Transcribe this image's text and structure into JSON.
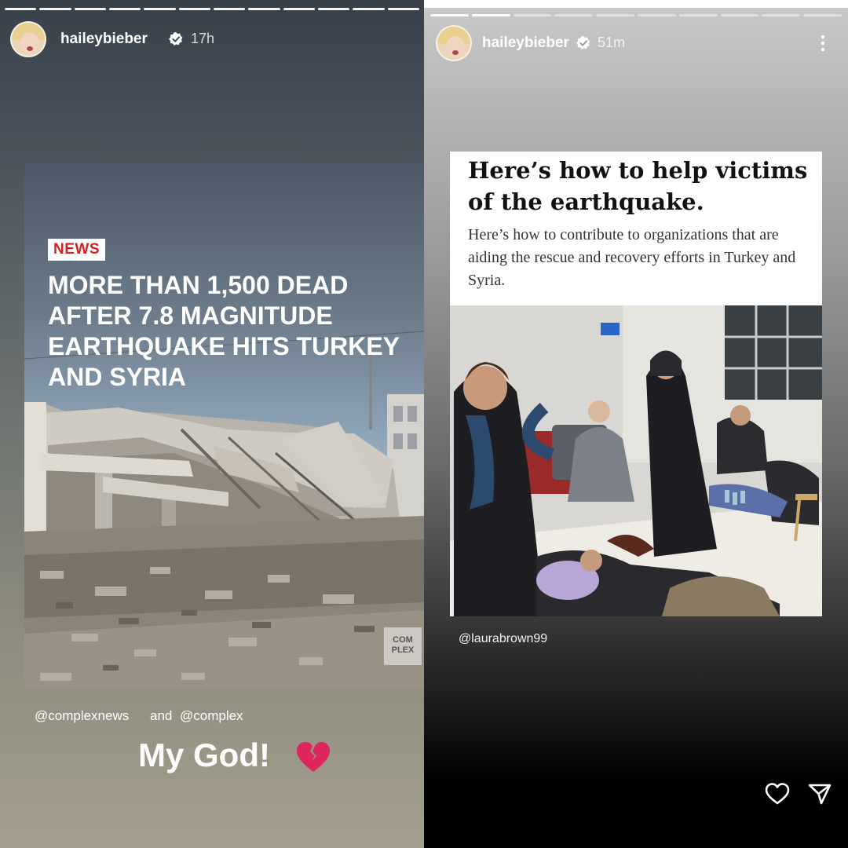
{
  "left_story": {
    "username": "haileybieber",
    "time": "17h",
    "news_badge": "NEWS",
    "headline": "MORE THAN 1,500 DEAD AFTER 7.8 MAGNITUDE EARTHQUAKE HITS TURKEY AND SYRIA",
    "watermark": "COM PLEX",
    "mention_1": "@complexnews",
    "mention_and": "and",
    "mention_2": "@complex",
    "caption": "My God!",
    "caption_emoji": "broken-heart-icon",
    "progress_segments": 12,
    "progress_done": 12
  },
  "right_story": {
    "username": "haileybieber",
    "time": "51m",
    "article_title": "Here’s how to help victims of the earthquake.",
    "article_subtitle": "Here’s how to contribute to organizations that are aiding the rescue and recovery efforts in Turkey and Syria.",
    "mention": "@laurabrown99",
    "progress_segments": 10,
    "progress_done": 2,
    "icons": [
      "more-options-icon",
      "heart-icon",
      "send-icon"
    ]
  },
  "colors": {
    "news_badge_text": "#d42020",
    "broken_heart": "#e0245e",
    "verified_badge": "#ffffff"
  }
}
